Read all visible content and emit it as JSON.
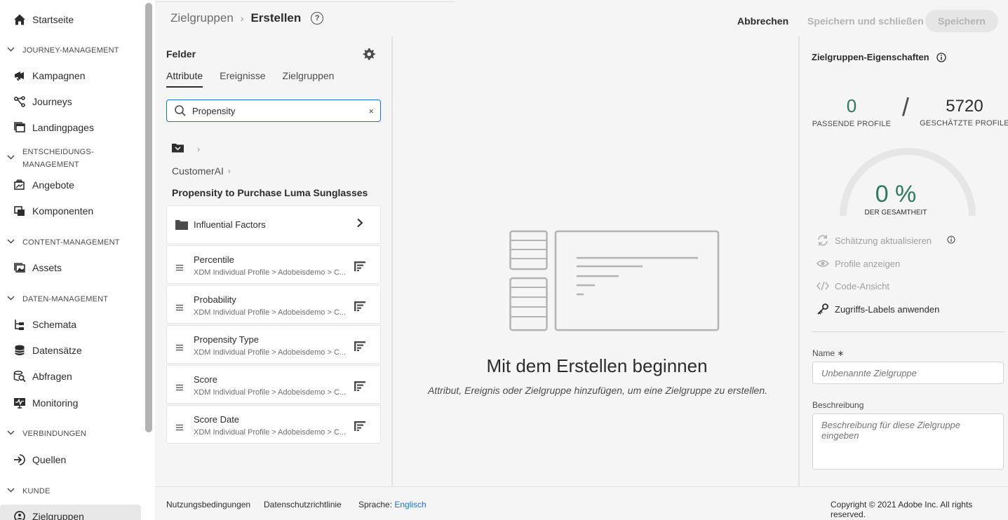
{
  "sidebar": {
    "home": {
      "label": "Startseite",
      "icon": "home-icon"
    },
    "sections": [
      {
        "title": "JOURNEY-MANAGEMENT"
      },
      {
        "title": "ENTSCHEIDUNGS-",
        "title2": "MANAGEMENT"
      },
      {
        "title": "CONTENT-MANAGEMENT"
      },
      {
        "title": "DATEN-MANAGEMENT"
      },
      {
        "title": "VERBINDUNGEN"
      },
      {
        "title": "KUNDE"
      }
    ],
    "items": [
      {
        "label": "Kampagnen",
        "icon": "megaphone-icon"
      },
      {
        "label": "Journeys",
        "icon": "journey-icon"
      },
      {
        "label": "Landingpages",
        "icon": "landing-page-icon"
      },
      {
        "label": "Angebote",
        "icon": "offers-icon"
      },
      {
        "label": "Komponenten",
        "icon": "components-icon"
      },
      {
        "label": "Assets",
        "icon": "assets-icon"
      },
      {
        "label": "Schemata",
        "icon": "schema-icon"
      },
      {
        "label": "Datensätze",
        "icon": "datasets-icon"
      },
      {
        "label": "Abfragen",
        "icon": "queries-icon"
      },
      {
        "label": "Monitoring",
        "icon": "monitoring-icon"
      },
      {
        "label": "Quellen",
        "icon": "sources-icon"
      },
      {
        "label": "Zielgruppen",
        "icon": "audiences-icon"
      }
    ]
  },
  "header": {
    "breadcrumb_parent": "Zielgruppen",
    "breadcrumb_current": "Erstellen",
    "help": "?",
    "cancel": "Abbrechen",
    "save_close": "Speichern und schließen",
    "save": "Speichern"
  },
  "fields": {
    "title": "Felder",
    "tabs": [
      "Attribute",
      "Ereignisse",
      "Zielgruppen"
    ],
    "search_value": "Propensity",
    "clear": "×",
    "path_item": "CustomerAI",
    "group_title": "Propensity to Purchase Luma Sunglasses",
    "folder_item": "Influential Factors",
    "items": [
      {
        "name": "Percentile",
        "path": "XDM Individual Profile > Adobeisdemo > C..."
      },
      {
        "name": "Probability",
        "path": "XDM Individual Profile > Adobeisdemo > C..."
      },
      {
        "name": "Propensity Type",
        "path": "XDM Individual Profile > Adobeisdemo > C..."
      },
      {
        "name": "Score",
        "path": "XDM Individual Profile > Adobeisdemo > C..."
      },
      {
        "name": "Score Date",
        "path": "XDM Individual Profile > Adobeisdemo > C..."
      }
    ]
  },
  "canvas": {
    "heading": "Mit dem Erstellen beginnen",
    "subtext": "Attribut, Ereignis oder Zielgruppe hinzufügen, um eine Zielgruppe zu erstellen."
  },
  "properties": {
    "title": "Zielgruppen-Eigenschaften",
    "matching_value": "0",
    "matching_label": "PASSENDE PROFILE",
    "estimated_value": "5720",
    "estimated_label": "GESCHÄTZTE PROFILE",
    "percent": "0 %",
    "percent_label": "DER GESAMTHEIT",
    "percent_fraction": 0,
    "actions": {
      "refresh": "Schätzung aktualisieren",
      "view_profiles": "Profile anzeigen",
      "code_view": "Code-Ansicht",
      "access_labels": "Zugriffs-Labels anwenden"
    },
    "name_label": "Name ∗",
    "name_placeholder": "Unbenannte Zielgruppe",
    "description_label": "Beschreibung",
    "description_placeholder": "Beschreibung für diese Zielgruppe eingeben"
  },
  "footer": {
    "terms": "Nutzungsbedingungen",
    "privacy": "Datenschutzrichtlinie",
    "language_label": "Sprache:",
    "language_value": "Englisch",
    "copyright": "Copyright ©  2021 Adobe Inc.  All rights reserved."
  },
  "colors": {
    "accent": "#1473e6",
    "positive": "#2d7a5e"
  }
}
